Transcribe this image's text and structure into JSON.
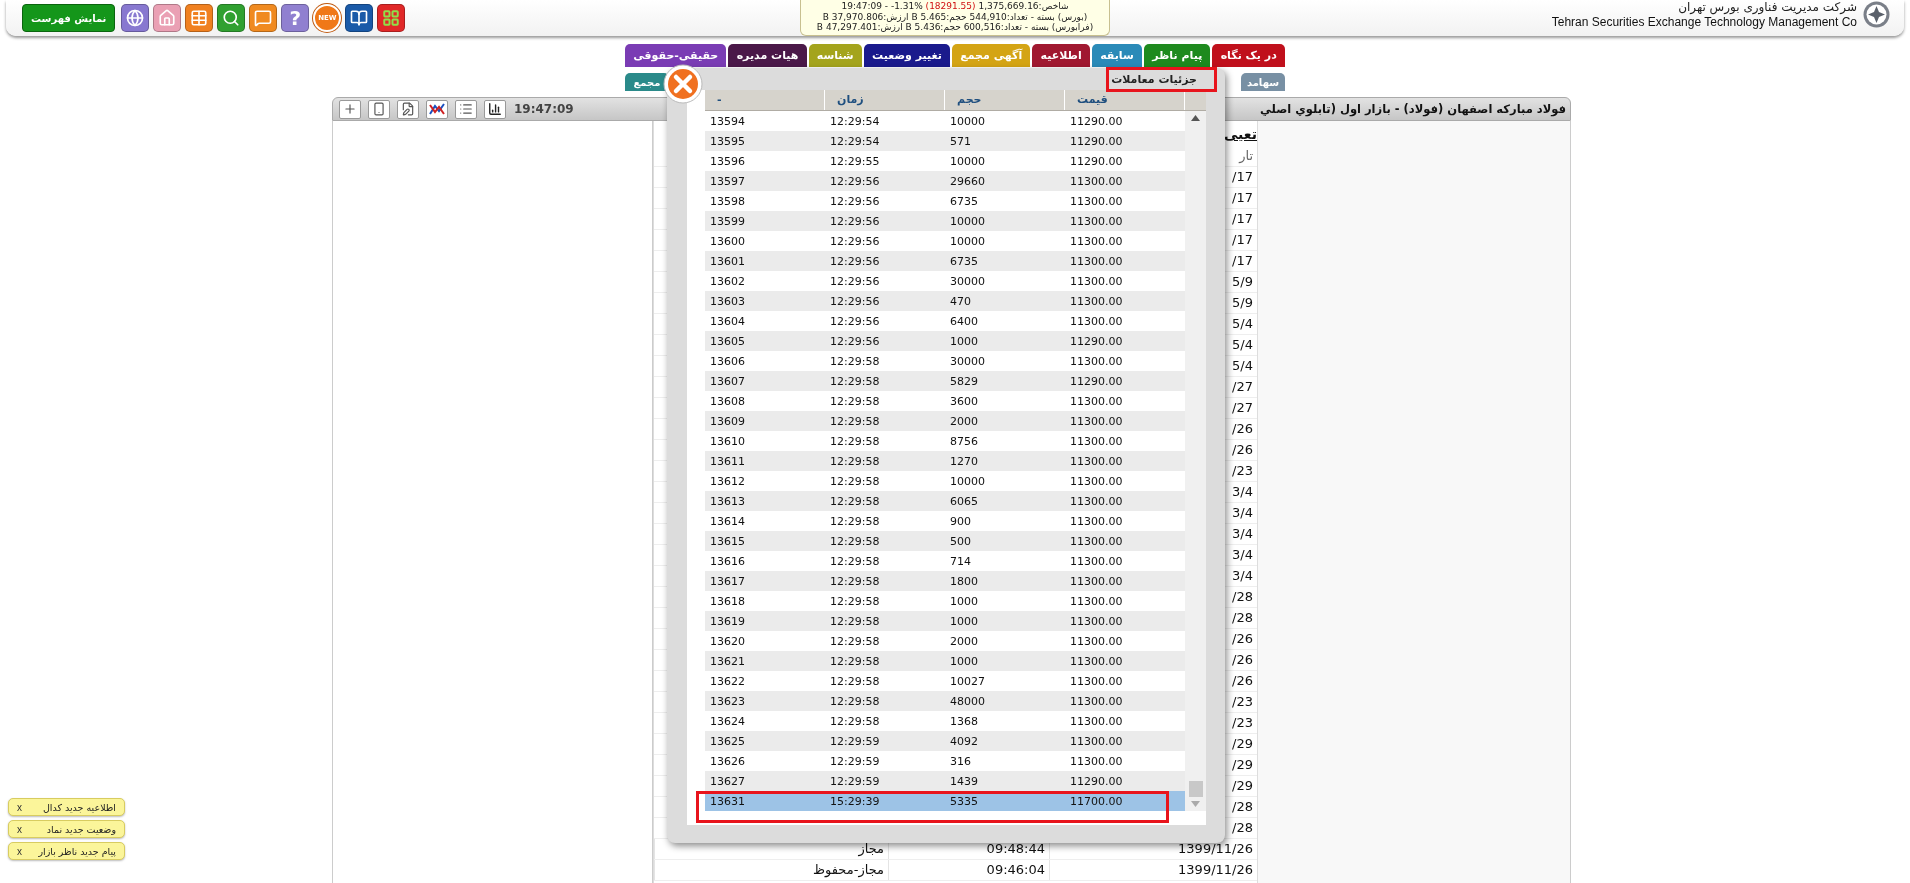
{
  "header": {
    "menu_button": "نمایش فهرست",
    "icons": [
      {
        "kind": "globe"
      },
      {
        "kind": "home"
      },
      {
        "kind": "table"
      },
      {
        "kind": "search"
      },
      {
        "kind": "chat"
      },
      {
        "kind": "help",
        "label": "?"
      },
      {
        "kind": "new",
        "label": "NEW"
      },
      {
        "kind": "book"
      },
      {
        "kind": "grid"
      }
    ],
    "ticker": {
      "index_value": "شاخص:1,375,669.16",
      "index_change": "(18291.55)",
      "index_rest": "%1.31- - 19:47:09",
      "lines": [
        "(بورس) بسته - تعداد:544,910 حجم:5.465 B ارزش:37,970.806 B",
        "(فرابورس) بسته - تعداد:600,516 حجم:5.436 B ارزش:47,297.401 B"
      ]
    },
    "company": {
      "name_fa": "شرکت مدیریت فناوری بورس تهران",
      "name_en": "Tehran Securities Exchange Technology Management Co"
    }
  },
  "tabs": {
    "row1": [
      {
        "label": "در یک نگاه",
        "color": "#c0101c",
        "selected": false
      },
      {
        "label": "پیام ناظر",
        "color": "#1e8a1e",
        "selected": false
      },
      {
        "label": "سابقه",
        "color": "#2a8ab8",
        "selected": false
      },
      {
        "label": "اطلاعیه",
        "color": "#a01830",
        "selected": false
      },
      {
        "label": "آگهی مجمع",
        "color": "#d4a414",
        "selected": false
      },
      {
        "label": "تغییر وضعیت",
        "color": "#1a1a8c",
        "selected": false
      },
      {
        "label": "شناسه",
        "color": "#a4a41c",
        "selected": false
      },
      {
        "label": "هیات مدیره",
        "color": "#4a1848",
        "selected": false
      },
      {
        "label": "حقیقی-حقوقی",
        "color": "#7a3cb4",
        "selected": false
      }
    ],
    "row2": [
      {
        "label": "سهامد",
        "color": "#7890a4",
        "selected": false
      },
      {
        "label": "مجمع",
        "color": "#2a8a8a",
        "selected": false
      }
    ]
  },
  "panel": {
    "toolbar": [
      {
        "kind": "add"
      },
      {
        "kind": "device"
      },
      {
        "kind": "edit"
      },
      {
        "kind": "trend"
      },
      {
        "kind": "list"
      },
      {
        "kind": "bars"
      }
    ],
    "time": "19:47:09",
    "title": "فولاد مبارکه اصفهان (فولاد) - بازار اول (تابلوي اصلي",
    "heading": "تعیی",
    "table": {
      "column_date": "تار",
      "rows": [
        {
          "date": "/17"
        },
        {
          "date": "/17"
        },
        {
          "date": "/17"
        },
        {
          "date": "/17"
        },
        {
          "date": "/17"
        },
        {
          "date": "5/9"
        },
        {
          "date": "5/9"
        },
        {
          "date": "5/4"
        },
        {
          "date": "5/4"
        },
        {
          "date": "5/4"
        },
        {
          "date": "/27"
        },
        {
          "date": "/27"
        },
        {
          "date": "/26"
        },
        {
          "date": "/26"
        },
        {
          "date": "/23"
        },
        {
          "date": "3/4"
        },
        {
          "date": "3/4"
        },
        {
          "date": "3/4"
        },
        {
          "date": "3/4"
        },
        {
          "date": "3/4"
        },
        {
          "date": "/28"
        },
        {
          "date": "/28"
        },
        {
          "date": "/26"
        },
        {
          "date": "/26"
        },
        {
          "date": "/26"
        },
        {
          "date": "/23"
        },
        {
          "date": "/23"
        },
        {
          "date": "/29"
        },
        {
          "date": "/29"
        },
        {
          "date": "/29"
        },
        {
          "date": "/28"
        },
        {
          "date": "/28"
        },
        {
          "date": "1399/11/26",
          "time": "09:48:44",
          "status": "مجاز"
        },
        {
          "date": "1399/11/26",
          "time": "09:46:04",
          "status": "مجاز-محفوظ"
        }
      ]
    }
  },
  "modal": {
    "title": "جزئیات معاملات",
    "columns": [
      "-",
      "زمان",
      "حجم",
      "قیمت"
    ],
    "rows": [
      {
        "cells": [
          "13594",
          "12:29:54",
          "10000",
          "11290.00"
        ],
        "selected": false
      },
      {
        "cells": [
          "13595",
          "12:29:54",
          "571",
          "11290.00"
        ],
        "selected": false
      },
      {
        "cells": [
          "13596",
          "12:29:55",
          "10000",
          "11290.00"
        ],
        "selected": false
      },
      {
        "cells": [
          "13597",
          "12:29:56",
          "29660",
          "11300.00"
        ],
        "selected": false
      },
      {
        "cells": [
          "13598",
          "12:29:56",
          "6735",
          "11300.00"
        ],
        "selected": false
      },
      {
        "cells": [
          "13599",
          "12:29:56",
          "10000",
          "11300.00"
        ],
        "selected": false
      },
      {
        "cells": [
          "13600",
          "12:29:56",
          "10000",
          "11300.00"
        ],
        "selected": false
      },
      {
        "cells": [
          "13601",
          "12:29:56",
          "6735",
          "11300.00"
        ],
        "selected": false
      },
      {
        "cells": [
          "13602",
          "12:29:56",
          "30000",
          "11300.00"
        ],
        "selected": false
      },
      {
        "cells": [
          "13603",
          "12:29:56",
          "470",
          "11300.00"
        ],
        "selected": false
      },
      {
        "cells": [
          "13604",
          "12:29:56",
          "6400",
          "11300.00"
        ],
        "selected": false
      },
      {
        "cells": [
          "13605",
          "12:29:56",
          "1000",
          "11290.00"
        ],
        "selected": false
      },
      {
        "cells": [
          "13606",
          "12:29:58",
          "30000",
          "11300.00"
        ],
        "selected": false
      },
      {
        "cells": [
          "13607",
          "12:29:58",
          "5829",
          "11290.00"
        ],
        "selected": false
      },
      {
        "cells": [
          "13608",
          "12:29:58",
          "3600",
          "11300.00"
        ],
        "selected": false
      },
      {
        "cells": [
          "13609",
          "12:29:58",
          "2000",
          "11300.00"
        ],
        "selected": false
      },
      {
        "cells": [
          "13610",
          "12:29:58",
          "8756",
          "11300.00"
        ],
        "selected": false
      },
      {
        "cells": [
          "13611",
          "12:29:58",
          "1270",
          "11300.00"
        ],
        "selected": false
      },
      {
        "cells": [
          "13612",
          "12:29:58",
          "10000",
          "11300.00"
        ],
        "selected": false
      },
      {
        "cells": [
          "13613",
          "12:29:58",
          "6065",
          "11300.00"
        ],
        "selected": false
      },
      {
        "cells": [
          "13614",
          "12:29:58",
          "900",
          "11300.00"
        ],
        "selected": false
      },
      {
        "cells": [
          "13615",
          "12:29:58",
          "500",
          "11300.00"
        ],
        "selected": false
      },
      {
        "cells": [
          "13616",
          "12:29:58",
          "714",
          "11300.00"
        ],
        "selected": false
      },
      {
        "cells": [
          "13617",
          "12:29:58",
          "1800",
          "11300.00"
        ],
        "selected": false
      },
      {
        "cells": [
          "13618",
          "12:29:58",
          "1000",
          "11300.00"
        ],
        "selected": false
      },
      {
        "cells": [
          "13619",
          "12:29:58",
          "1000",
          "11300.00"
        ],
        "selected": false
      },
      {
        "cells": [
          "13620",
          "12:29:58",
          "2000",
          "11300.00"
        ],
        "selected": false
      },
      {
        "cells": [
          "13621",
          "12:29:58",
          "1000",
          "11300.00"
        ],
        "selected": false
      },
      {
        "cells": [
          "13622",
          "12:29:58",
          "10027",
          "11300.00"
        ],
        "selected": false
      },
      {
        "cells": [
          "13623",
          "12:29:58",
          "48000",
          "11300.00"
        ],
        "selected": false
      },
      {
        "cells": [
          "13624",
          "12:29:58",
          "1368",
          "11300.00"
        ],
        "selected": false
      },
      {
        "cells": [
          "13625",
          "12:29:59",
          "4092",
          "11300.00"
        ],
        "selected": false
      },
      {
        "cells": [
          "13626",
          "12:29:59",
          "316",
          "11300.00"
        ],
        "selected": false
      },
      {
        "cells": [
          "13627",
          "12:29:59",
          "1439",
          "11290.00"
        ],
        "selected": false
      },
      {
        "cells": [
          "13631",
          "15:29:39",
          "5335",
          "11700.00"
        ],
        "selected": true
      }
    ]
  },
  "notifications": [
    {
      "text": "اطلاعیه جدید کدال",
      "dismiss": "x"
    },
    {
      "text": "وضعیت جدید نماد",
      "dismiss": "x"
    },
    {
      "text": "پیام جدید ناظر بازار",
      "dismiss": "x"
    }
  ]
}
